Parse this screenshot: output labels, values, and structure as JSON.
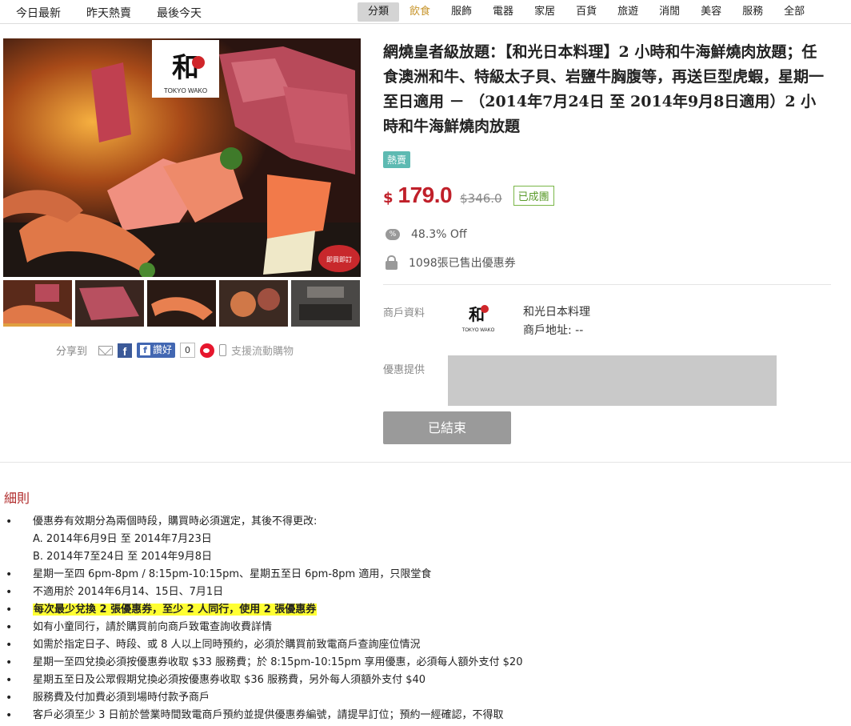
{
  "nav": {
    "left_links": [
      "今日最新",
      "昨天熱賣",
      "最後今天"
    ],
    "categories": [
      "分類",
      "飲食",
      "服飾",
      "電器",
      "家居",
      "百貨",
      "旅遊",
      "消閒",
      "美容",
      "服務",
      "全部"
    ],
    "active_category": "分類",
    "highlight_category": "飲食"
  },
  "gallery": {
    "logo_text": "TOKYO WAKO",
    "stamp_text": "即買即訂",
    "thumbnail_count": 5
  },
  "share": {
    "label": "分享到",
    "fb_like": "讚好",
    "fb_count": "0",
    "mobile_text": "支援流動購物"
  },
  "deal": {
    "title": "網燒皇者級放題：【和光日本料理】2 小時和牛海鮮燒肉放題；任食澳洲和牛、特級太子貝、岩鹽牛胸腹等，再送巨型虎蝦，星期一至日適用 － （2014年7月24日 至 2014年9月8日適用）2 小時和牛海鮮燒肉放題",
    "badge": "熱賣",
    "currency": "$",
    "price": "179.0",
    "original_price": "$346.0",
    "status": "已成團",
    "discount": "48.3% Off",
    "sold": "1098張已售出優惠券"
  },
  "merchant": {
    "label": "商戶資料",
    "name": "和光日本料理",
    "address": "商戶地址: --",
    "offer_label": "優惠提供",
    "button": "已結束"
  },
  "rules": {
    "title": "細則",
    "items": [
      {
        "text": "優惠券有效期分為兩個時段，購買時必須選定，其後不得更改:",
        "bullet": true,
        "highlight": false
      },
      {
        "text": "A.  2014年6月9日 至 2014年7月23日",
        "bullet": false,
        "highlight": false
      },
      {
        "text": "B.  2014年7至24日 至 2014年9月8日",
        "bullet": false,
        "highlight": false
      },
      {
        "text": "星期一至四 6pm-8pm / 8:15pm-10:15pm、星期五至日 6pm-8pm 適用，只限堂食",
        "bullet": true,
        "highlight": false
      },
      {
        "text": "不適用於 2014年6月14、15日、7月1日",
        "bullet": true,
        "highlight": false
      },
      {
        "text": "每次最少兌換 2 張優惠券，至少 2 人同行，使用 2 張優惠券",
        "bullet": true,
        "highlight": true
      },
      {
        "text": "如有小童同行，請於購買前向商戶致電查詢收費詳情",
        "bullet": true,
        "highlight": false
      },
      {
        "text": "如需於指定日子、時段、或 8 人以上同時預約，必須於購買前致電商戶查詢座位情況",
        "bullet": true,
        "highlight": false
      },
      {
        "text": "星期一至四兌換必須按優惠券收取 $33 服務費；於 8:15pm-10:15pm 享用優惠，必須每人額外支付 $20",
        "bullet": true,
        "highlight": false
      },
      {
        "text": "星期五至日及公眾假期兌換必須按優惠券收取 $36 服務費，另外每人須額外支付 $40",
        "bullet": true,
        "highlight": false
      },
      {
        "text": "服務費及付加費必須到場時付款予商戶",
        "bullet": true,
        "highlight": false
      },
      {
        "text": "客戶必須至少 3 日前於營業時間致電商戶預約並提供優惠券編號，請提早訂位；預約一經確認，不得取",
        "bullet": true,
        "highlight": false
      }
    ]
  }
}
